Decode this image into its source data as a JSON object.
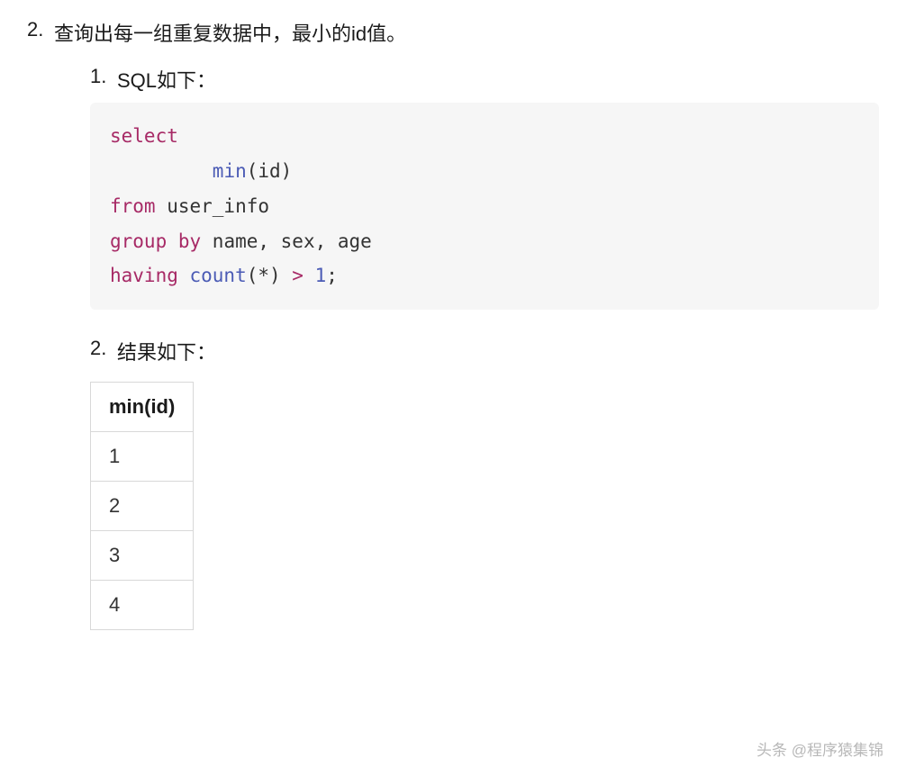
{
  "outer": {
    "marker": "2.",
    "text": "查询出每一组重复数据中，最小的id值。"
  },
  "inner1": {
    "marker": "1.",
    "text": "SQL如下："
  },
  "code": {
    "k_select": "select",
    "f_min": "min",
    "id": "(id)",
    "k_from": "from",
    "tbl": " user_info",
    "k_group": "group",
    "k_by": " by",
    "cols": " name, sex, age",
    "k_having": "having",
    "f_count": " count",
    "star": "(*) ",
    "gt": ">",
    "sp": " ",
    "one": "1",
    "semi": ";"
  },
  "inner2": {
    "marker": "2.",
    "text": "结果如下："
  },
  "table": {
    "header": "min(id)",
    "rows": [
      "1",
      "2",
      "3",
      "4"
    ]
  },
  "watermark": "头条 @程序猿集锦"
}
